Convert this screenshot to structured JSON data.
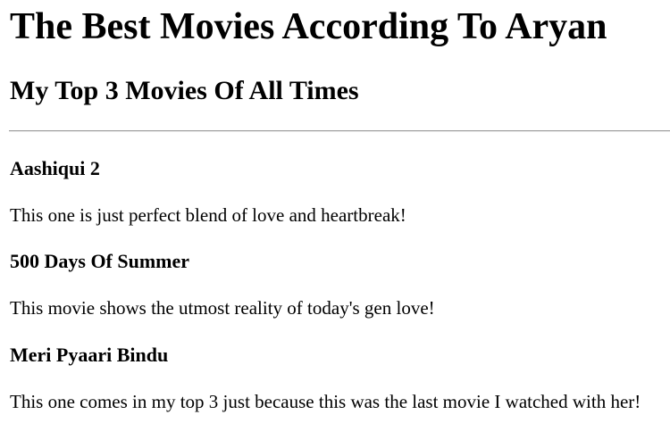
{
  "page": {
    "title": "The Best Movies According To Aryan",
    "subtitle": "My Top 3 Movies Of All Times"
  },
  "movies": [
    {
      "title": "Aashiqui 2",
      "description": "This one is just perfect blend of love and heartbreak!"
    },
    {
      "title": "500 Days Of Summer",
      "description": "This movie shows the utmost reality of today's gen love!"
    },
    {
      "title": "Meri Pyaari Bindu",
      "description": "This one comes in my top 3 just because this was the last movie I watched with her!"
    }
  ]
}
